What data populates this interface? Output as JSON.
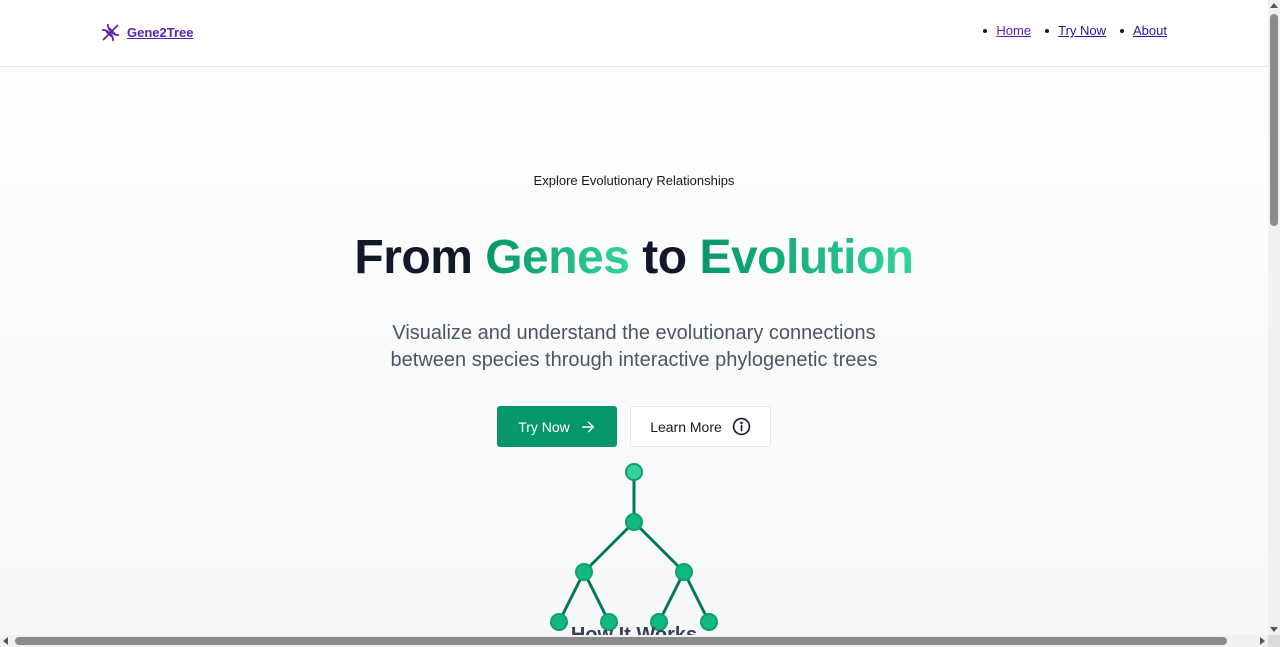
{
  "header": {
    "brand_label": "Gene2Tree",
    "brand_icon": "dna-icon",
    "nav": [
      {
        "label": "Home"
      },
      {
        "label": "Try Now"
      },
      {
        "label": "About"
      }
    ]
  },
  "hero": {
    "eyebrow": "Explore Evolutionary Relationships",
    "headline": {
      "part1": "From ",
      "accent1": "Genes",
      "part2": " to ",
      "accent2": "Evolution"
    },
    "subtitle_line1": "Visualize and understand the evolutionary connections",
    "subtitle_line2": "between species through interactive phylogenetic trees",
    "primary_cta": {
      "label": "Try Now",
      "icon": "arrow-right-icon"
    },
    "secondary_cta": {
      "label": "Learn More",
      "icon": "info-circle-icon"
    },
    "illustration": "phylogenetic-tree-icon",
    "partial_text": "How It Works"
  },
  "colors": {
    "brand": "#5b21b6",
    "accent_green": "#059669",
    "accent_green_light": "#34d399",
    "heading": "#111827",
    "body_text": "#4b5563"
  }
}
